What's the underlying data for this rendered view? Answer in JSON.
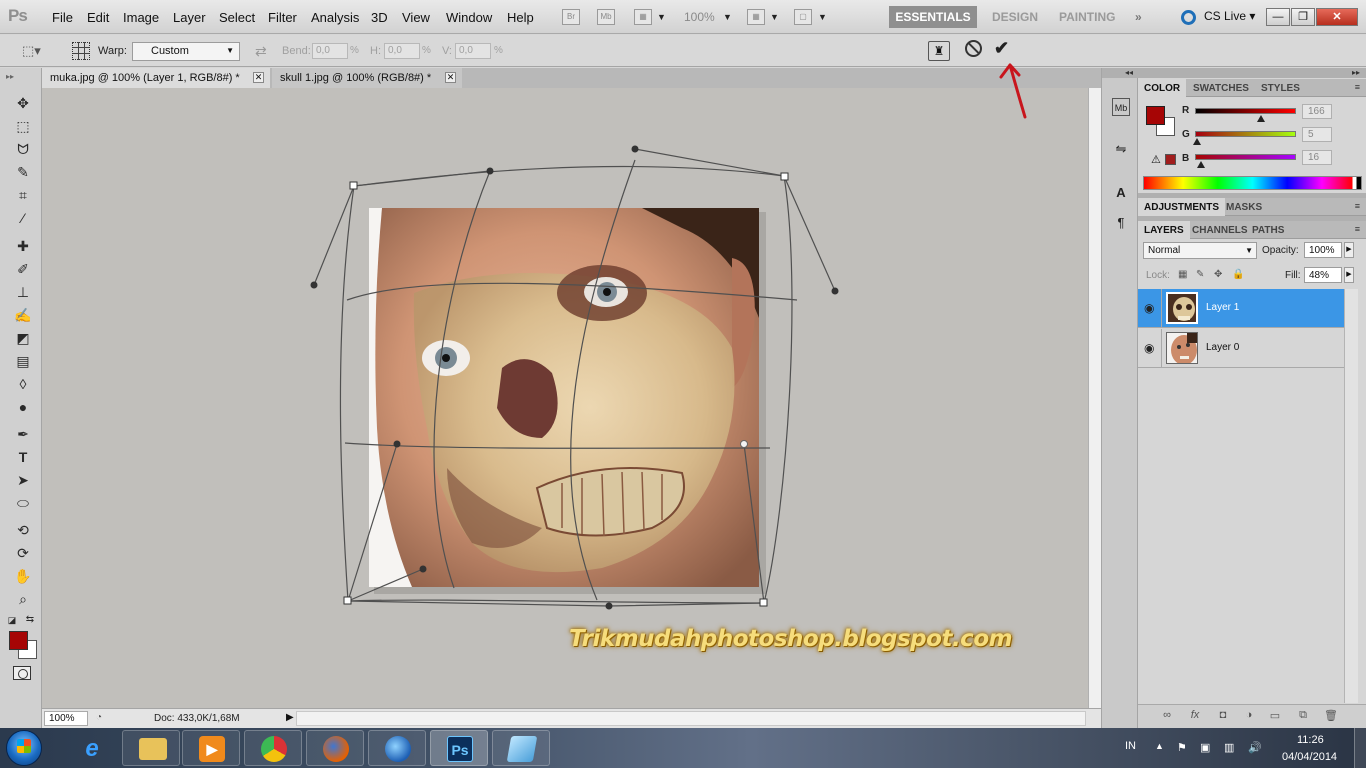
{
  "app": {
    "logo": "Ps",
    "menu": [
      "File",
      "Edit",
      "Image",
      "Layer",
      "Select",
      "Filter",
      "Analysis",
      "3D",
      "View",
      "Window",
      "Help"
    ],
    "zoom_level": "100%",
    "workspaces": {
      "active": "ESSENTIALS",
      "others": [
        "DESIGN",
        "PAINTING"
      ]
    },
    "cs_live": "CS Live",
    "window_buttons": {
      "minimize": "—",
      "restore": "❐",
      "close": "✕"
    }
  },
  "options_bar": {
    "warp_label": "Warp:",
    "warp_style": "Custom",
    "bend_label": "Bend:",
    "bend_value": "0,0",
    "h_label": "H:",
    "h_value": "0,0",
    "v_label": "V:",
    "v_value": "0,0",
    "pct": "%"
  },
  "documents": [
    {
      "title": "muka.jpg @ 100% (Layer 1, RGB/8#) *",
      "active": true
    },
    {
      "title": "skull 1.jpg @ 100% (RGB/8#) *",
      "active": false
    }
  ],
  "status_bar": {
    "zoom": "100%",
    "doc_info": "Doc: 433,0K/1,68M"
  },
  "canvas": {
    "watermark": "Trikmudahphotoshop.blogspot.com"
  },
  "color_panel": {
    "tabs": [
      "COLOR",
      "SWATCHES",
      "STYLES"
    ],
    "r_label": "R",
    "g_label": "G",
    "b_label": "B",
    "r": "166",
    "g": "5",
    "b": "16",
    "r_fraction": 0.651,
    "g_fraction": 0.02,
    "b_fraction": 0.063,
    "fg_color": "#a60510",
    "bg_color": "#ffffff"
  },
  "adjustments_panel": {
    "tabs": [
      "ADJUSTMENTS",
      "MASKS"
    ]
  },
  "layers_panel": {
    "tabs": [
      "LAYERS",
      "CHANNELS",
      "PATHS"
    ],
    "blend_mode": "Normal",
    "opacity_label": "Opacity:",
    "opacity": "100%",
    "lock_label": "Lock:",
    "fill_label": "Fill:",
    "fill": "48%",
    "layers": [
      {
        "name": "Layer 1",
        "selected": true
      },
      {
        "name": "Layer 0",
        "selected": false
      }
    ]
  },
  "taskbar": {
    "language": "IN",
    "time": "11:26",
    "date": "04/04/2014"
  },
  "colors": {
    "selection_blue": "#3b96e6",
    "annotation_red": "#c8151c",
    "canvas_bg": "#c1bfbb"
  }
}
